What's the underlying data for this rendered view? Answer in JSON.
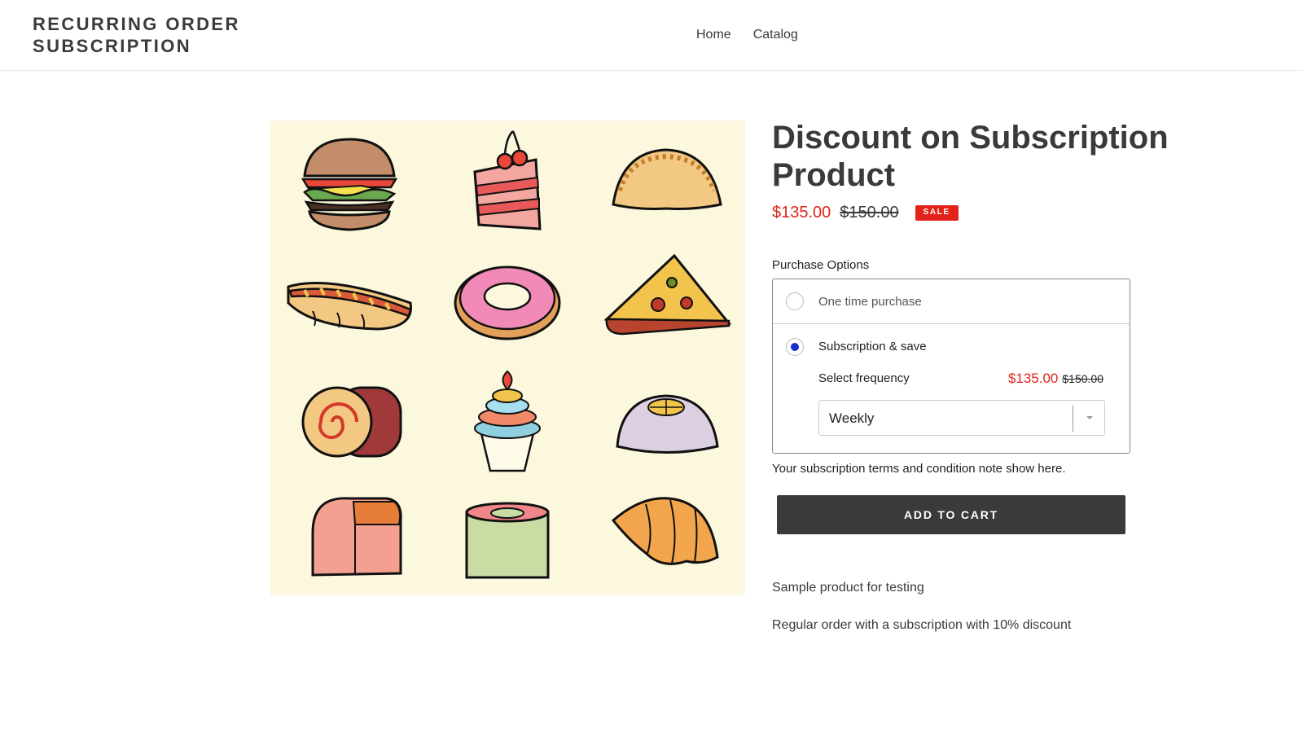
{
  "header": {
    "logo_line1": "RECURRING ORDER",
    "logo_line2": "SUBSCRIPTION",
    "nav": [
      {
        "label": "Home"
      },
      {
        "label": "Catalog"
      }
    ]
  },
  "product": {
    "title": "Discount on Subscription Product",
    "sale_price": "$135.00",
    "compare_price": "$150.00",
    "badge": "SALE",
    "image_icons": [
      "burger-icon",
      "cake-slice-icon",
      "taco-icon",
      "hotdog-icon",
      "donut-icon",
      "pizza-slice-icon",
      "swiss-roll-icon",
      "cupcake-icon",
      "pudding-icon",
      "bread-icon",
      "sushi-icon",
      "croissant-icon"
    ]
  },
  "purchase": {
    "label": "Purchase Options",
    "one_time_label": "One time purchase",
    "subscription_label": "Subscription & save",
    "selected_option": "subscription",
    "frequency_label": "Select frequency",
    "frequency_sale_price": "$135.00",
    "frequency_compare_price": "$150.00",
    "frequency_selected": "Weekly"
  },
  "terms_note": "Your subscription terms and condition note show here.",
  "add_to_cart_label": "ADD TO CART",
  "description": {
    "line1": "Sample product for testing",
    "line2": "Regular order with a subscription with 10% discount"
  },
  "colors": {
    "sale_red": "#e3231a",
    "button_dark": "#3a3a3a",
    "radio_selected": "#1a2fd0",
    "image_background": "#fcf8dd"
  }
}
